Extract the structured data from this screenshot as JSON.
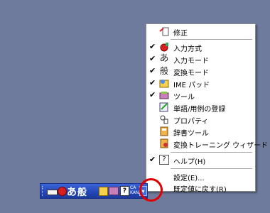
{
  "menu": {
    "items": [
      {
        "label": "修正",
        "checked": false,
        "icon": "edit-icon"
      },
      {
        "label": "入力方式",
        "checked": true,
        "icon": "input-method-icon"
      },
      {
        "label": "入力モード",
        "checked": true,
        "icon": "hiragana-a-icon",
        "glyph": "あ"
      },
      {
        "label": "変換モード",
        "checked": true,
        "icon": "conversion-kanji-icon",
        "glyph": "般"
      },
      {
        "label": "IME パッド",
        "checked": true,
        "icon": "ime-pad-icon"
      },
      {
        "label": "ツール",
        "checked": true,
        "icon": "tool-book-icon"
      },
      {
        "label": "単語/用例の登録",
        "checked": false,
        "icon": "word-register-icon"
      },
      {
        "label": "プロパティ",
        "checked": false,
        "icon": "properties-icon"
      },
      {
        "label": "辞書ツール",
        "checked": false,
        "icon": "dictionary-tool-icon"
      },
      {
        "label": "変換トレーニング ウィザード",
        "checked": false,
        "icon": "training-wizard-icon"
      },
      {
        "label": "ヘルプ(H)",
        "checked": true,
        "icon": "help-icon",
        "glyph": "?"
      },
      {
        "label": "設定(E)...",
        "checked": false,
        "icon": ""
      },
      {
        "label": "既定値に戻す(R)",
        "checked": false,
        "icon": ""
      }
    ]
  },
  "langbar": {
    "mode_glyph": "あ",
    "conv_glyph": "般",
    "help_glyph": "?",
    "caps_top": "CA",
    "caps_bottom": "KANA",
    "dropdown_glyph": "▾"
  },
  "colors": {
    "desktop": "#6e7b9c",
    "langbar": "#2448b8",
    "highlight_circle": "#e00000"
  }
}
